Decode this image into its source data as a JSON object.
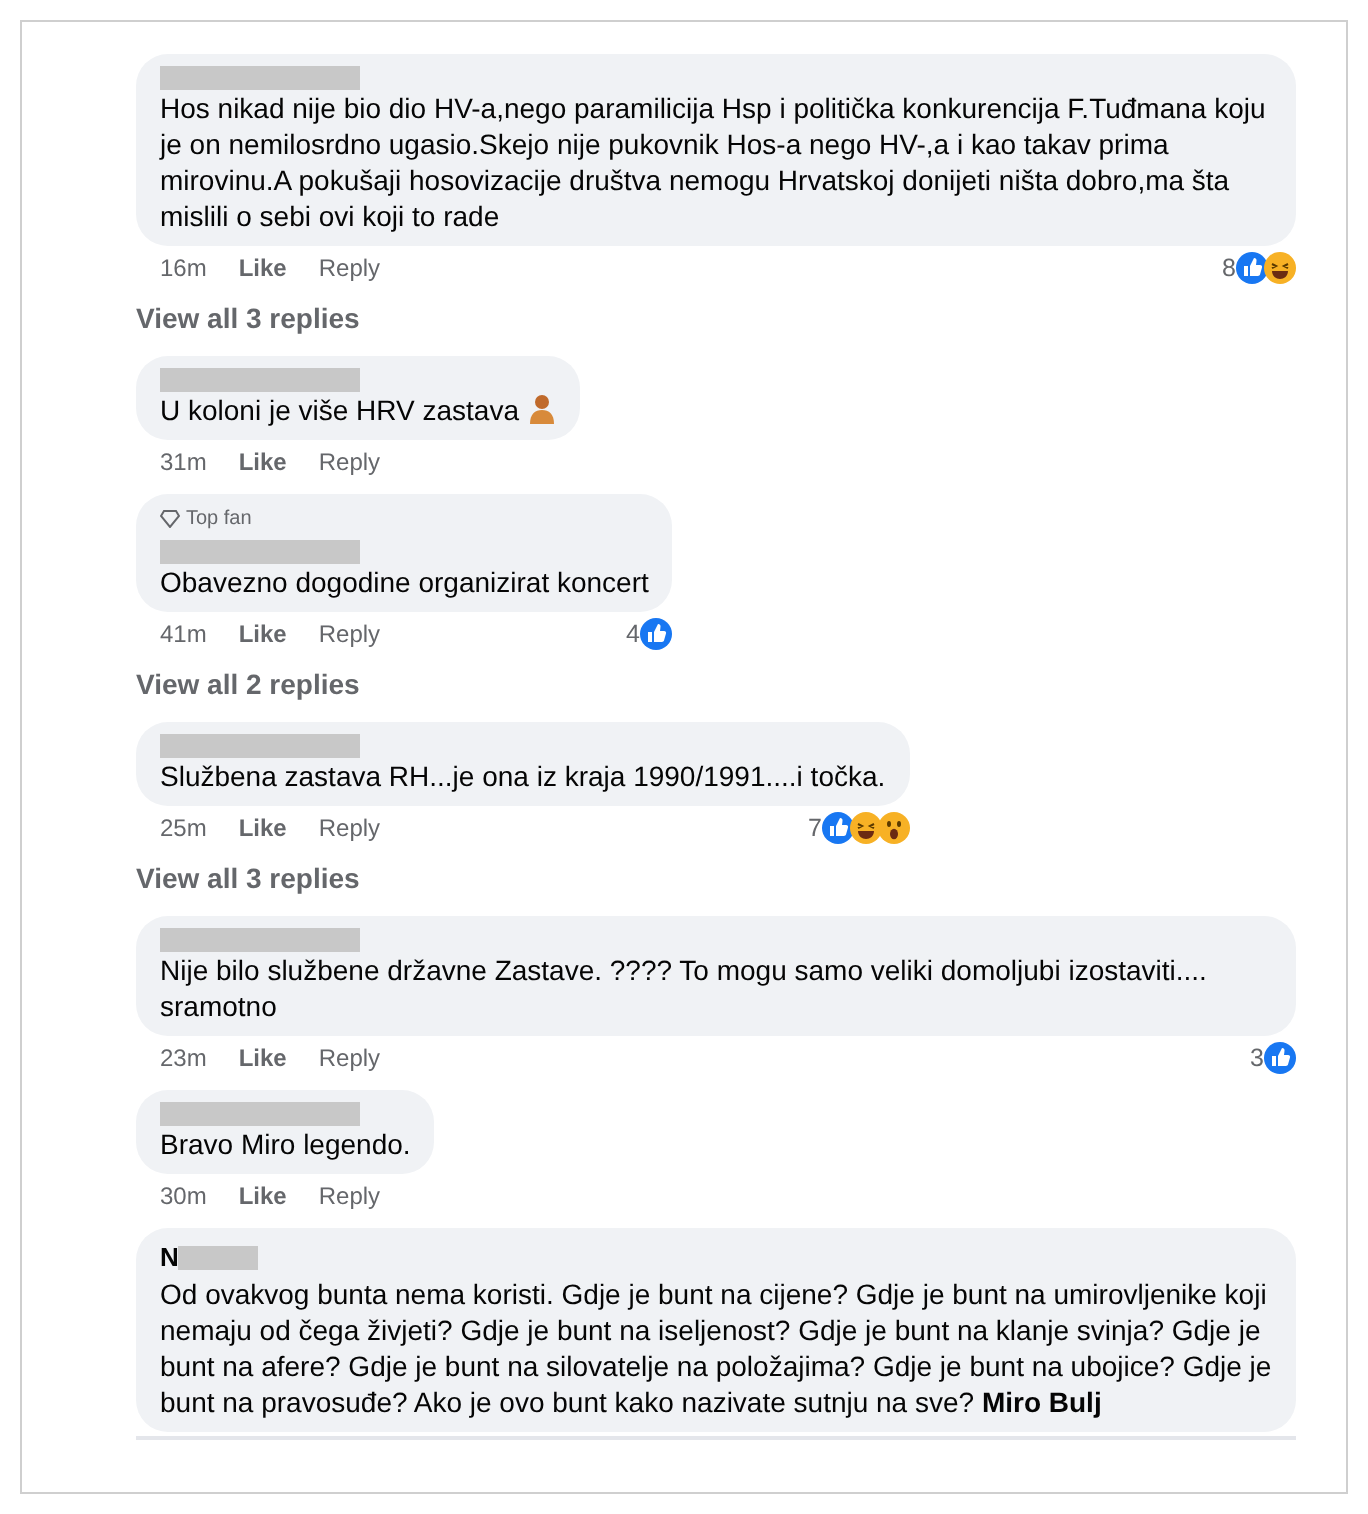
{
  "items": [
    {
      "kind": "comment",
      "redacted": true,
      "text": "Hos nikad nije bio dio HV-a,nego paramilicija Hsp i politička konkurencija F.Tuđmana koju je on nemilosrdno ugasio.Skejo nije pukovnik Hos-a nego HV-,a i kao takav prima mirovinu.A pokušaji hosovizacije društva nemogu Hrvatskoj donijeti ništa dobro,ma šta mislili o sebi ovi koji to rade",
      "time": "16m",
      "actions": [
        "Like",
        "Reply"
      ],
      "reaction_count": "8",
      "reactions": [
        {
          "kind": "like"
        },
        {
          "kind": "haha"
        }
      ]
    },
    {
      "kind": "replies",
      "label": "View all 3 replies"
    },
    {
      "kind": "comment",
      "redacted": true,
      "text": "U koloni je više HRV zastava",
      "emoji": true,
      "time": "31m",
      "actions": [
        "Like",
        "Reply"
      ]
    },
    {
      "kind": "comment",
      "badge": "Top fan",
      "redacted": true,
      "text": "Obavezno dogodine organizirat koncert",
      "time": "41m",
      "actions": [
        "Like",
        "Reply"
      ],
      "reaction_count": "4",
      "reactions": [
        {
          "kind": "like"
        }
      ]
    },
    {
      "kind": "replies",
      "label": "View all 2 replies"
    },
    {
      "kind": "comment",
      "redacted": true,
      "text": "Službena zastava RH...je ona iz kraja 1990/1991....i točka.",
      "time": "25m",
      "actions": [
        "Like",
        "Reply"
      ],
      "reaction_count": "7",
      "reactions": [
        {
          "kind": "like"
        },
        {
          "kind": "haha"
        },
        {
          "kind": "wow"
        }
      ]
    },
    {
      "kind": "replies",
      "label": "View all 3 replies"
    },
    {
      "kind": "comment",
      "redacted": true,
      "text": "Nije bilo službene državne Zastave. ???? To mogu samo veliki domoljubi izostaviti.... sramotno",
      "time": "23m",
      "actions": [
        "Like",
        "Reply"
      ],
      "reaction_count": "3",
      "reactions": [
        {
          "kind": "like"
        }
      ]
    },
    {
      "kind": "comment",
      "redacted": true,
      "text": "Bravo Miro legendo.",
      "time": "30m",
      "actions": [
        "Like",
        "Reply"
      ]
    },
    {
      "kind": "comment",
      "author": "N",
      "redacted": true,
      "text": "Od ovakvog bunta nema koristi. Gdje je bunt na cijene? Gdje je bunt na umirovljenike koji nemaju od čega živjeti? Gdje je bunt na iseljenost? Gdje je bunt na klanje svinja? Gdje je bunt na afere? Gdje je bunt na silovatelje na položajima? Gdje je bunt na ubojice? Gdje je bunt na pravosuđe? Ako je ovo bunt kako nazivate sutnju na sve? **Miro Bulj**"
    }
  ]
}
